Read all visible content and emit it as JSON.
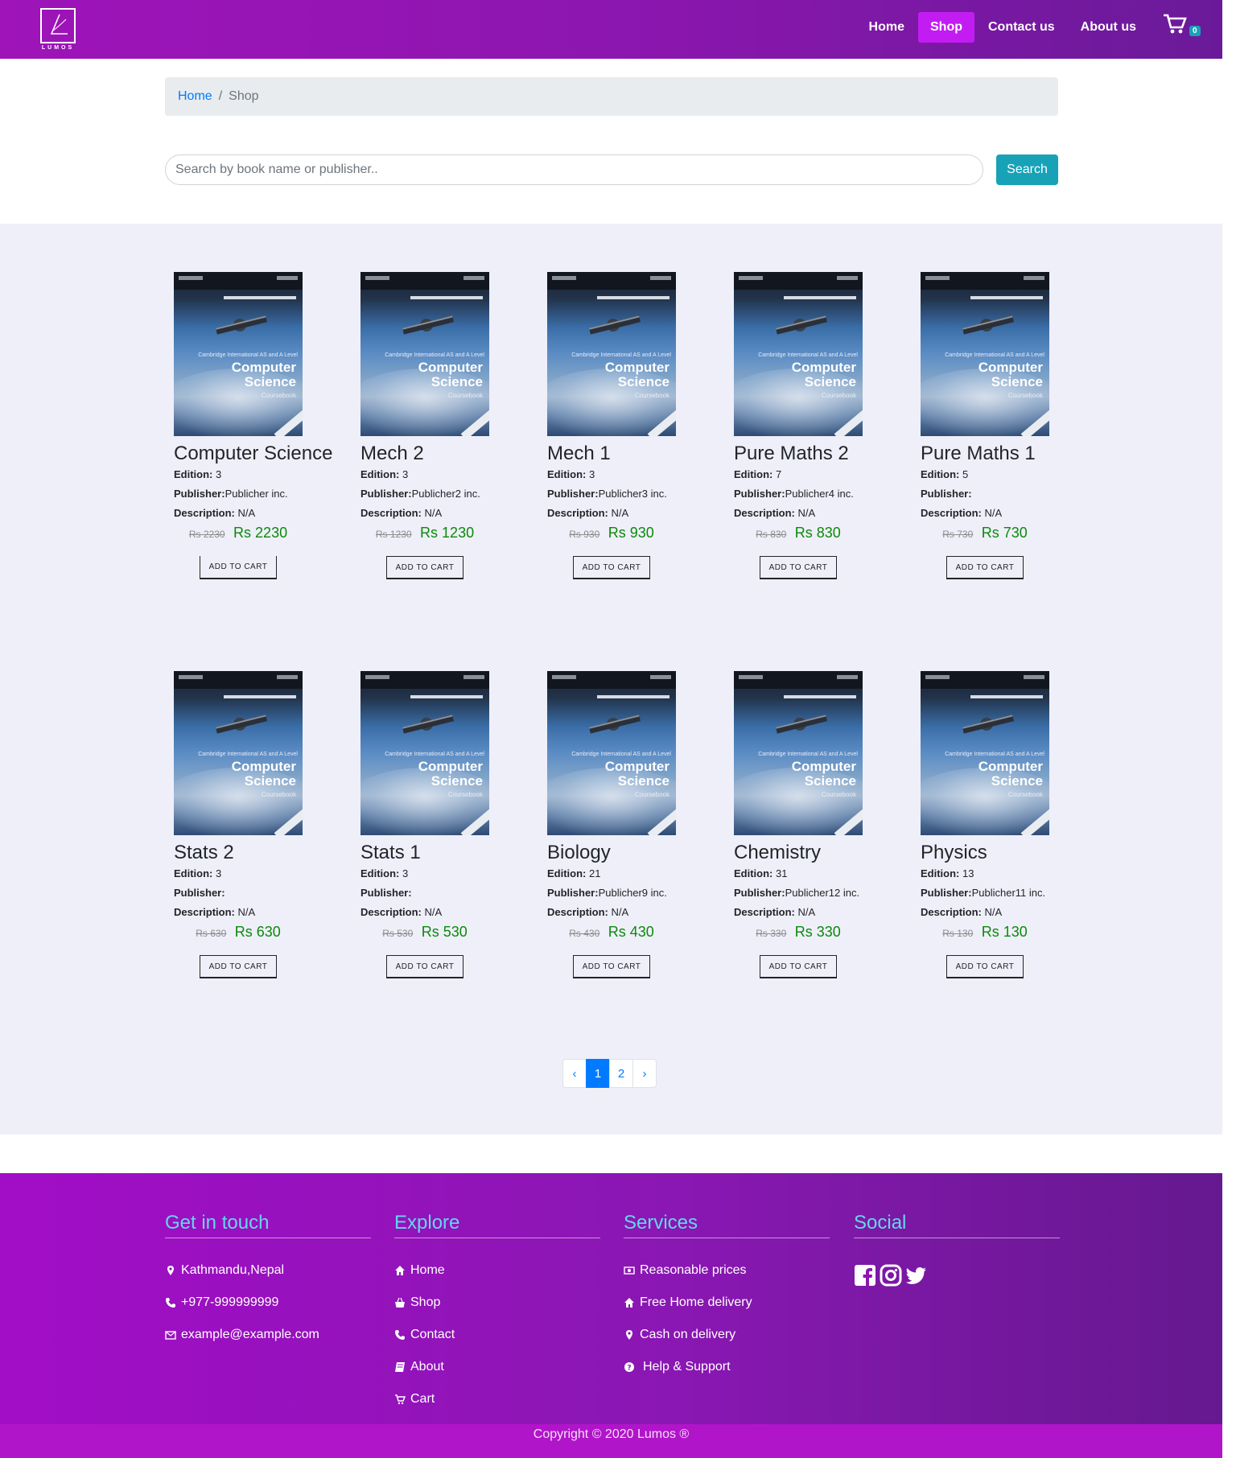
{
  "nav": {
    "logo_text": "LUMOS",
    "links": [
      "Home",
      "Shop",
      "Contact us",
      "About us"
    ],
    "cart_count": "0"
  },
  "breadcrumb": {
    "home": "Home",
    "separator": "/",
    "current": "Shop"
  },
  "search": {
    "placeholder": "Search by book name or publisher..",
    "button": "Search"
  },
  "cover": {
    "authors": "Sylvia Langfield and Dave Duddell",
    "series": "Cambridge International AS and A Level",
    "title_line1": "Computer",
    "title_line2": "Science",
    "subtitle": "Coursebook"
  },
  "labels": {
    "edition": "Edition:",
    "publisher": "Publisher:",
    "description": "Description:",
    "add_to_cart": "ADD TO CART"
  },
  "products": [
    {
      "title": "Computer Science",
      "edition": "3",
      "publisher": "Publicher inc.",
      "description": "N/A",
      "old_price": "Rs 2230",
      "price": "Rs 2230"
    },
    {
      "title": "Mech 2",
      "edition": "3",
      "publisher": "Publicher2 inc.",
      "description": "N/A",
      "old_price": "Rs 1230",
      "price": "Rs 1230"
    },
    {
      "title": "Mech 1",
      "edition": "3",
      "publisher": "Publicher3 inc.",
      "description": "N/A",
      "old_price": "Rs 930",
      "price": "Rs 930"
    },
    {
      "title": "Pure Maths 2",
      "edition": "7",
      "publisher": "Publicher4 inc.",
      "description": "N/A",
      "old_price": "Rs 830",
      "price": "Rs 830"
    },
    {
      "title": "Pure Maths 1",
      "edition": "5",
      "publisher": "",
      "description": "N/A",
      "old_price": "Rs 730",
      "price": "Rs 730"
    },
    {
      "title": "Stats 2",
      "edition": "3",
      "publisher": "",
      "description": "N/A",
      "old_price": "Rs 630",
      "price": "Rs 630"
    },
    {
      "title": "Stats 1",
      "edition": "3",
      "publisher": "",
      "description": "N/A",
      "old_price": "Rs 530",
      "price": "Rs 530"
    },
    {
      "title": "Biology",
      "edition": "21",
      "publisher": "Publicher9 inc.",
      "description": "N/A",
      "old_price": "Rs 430",
      "price": "Rs 430"
    },
    {
      "title": "Chemistry",
      "edition": "31",
      "publisher": "Publicher12 inc.",
      "description": "N/A",
      "old_price": "Rs 330",
      "price": "Rs 330"
    },
    {
      "title": "Physics",
      "edition": "13",
      "publisher": "Publicher11 inc.",
      "description": "N/A",
      "old_price": "Rs 130",
      "price": "Rs 130"
    }
  ],
  "pagination": {
    "prev": "‹",
    "pages": [
      "1",
      "2"
    ],
    "active": "1",
    "next": "›"
  },
  "footer": {
    "get_in_touch": {
      "heading": "Get in touch",
      "items": [
        "Kathmandu,Nepal",
        "+977-999999999",
        "example@example.com"
      ]
    },
    "explore": {
      "heading": "Explore",
      "items": [
        "Home",
        "Shop",
        "Contact",
        "About",
        "Cart"
      ]
    },
    "services": {
      "heading": "Services",
      "items": [
        "Reasonable prices",
        "Free Home delivery",
        "Cash on delivery",
        "Help & Support"
      ]
    },
    "social": {
      "heading": "Social",
      "icons": [
        "facebook-icon",
        "instagram-icon",
        "twitter-icon"
      ]
    },
    "copyright": "Copyright © 2020 Lumos ®"
  },
  "colors": {
    "nav_gradient_start": "#9e14b8",
    "nav_active": "#c21cf3",
    "accent_teal": "#17a2b8",
    "price_green": "#0a8a0a",
    "footer_heading": "#62d7ec",
    "shop_bg": "#efeff9"
  }
}
